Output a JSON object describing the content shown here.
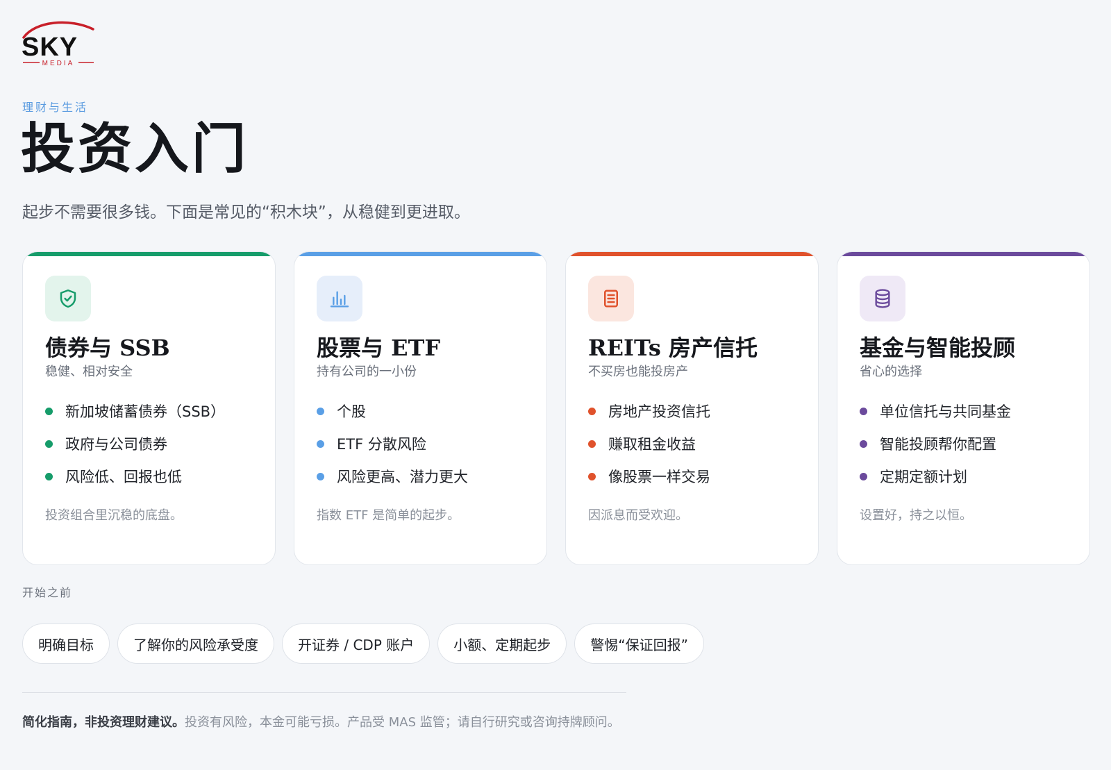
{
  "brand": {
    "logo_main": "SKY",
    "logo_sub": "MEDIA"
  },
  "header": {
    "eyebrow": "理财与生活",
    "title": "投资入门",
    "subtitle": "起步不需要很多钱。下面是常见的“积木块”，从稳健到更进取。"
  },
  "colors": {
    "green": "#169c6a",
    "blue": "#5a9fe6",
    "orange": "#e0522c",
    "purple": "#6b4a9c"
  },
  "cards": [
    {
      "icon": "shield-check-icon",
      "accent": "#169c6a",
      "icon_bg": "#e3f4ec",
      "title": "债券与 SSB",
      "subtitle": "稳健、相对安全",
      "items": [
        "新加坡储蓄债券（SSB）",
        "政府与公司债券",
        "风险低、回报也低"
      ],
      "note": "投资组合里沉稳的底盘。"
    },
    {
      "icon": "bar-chart-icon",
      "accent": "#5a9fe6",
      "icon_bg": "#e6eefa",
      "title": "股票与 ETF",
      "subtitle": "持有公司的一小份",
      "items": [
        "个股",
        "ETF 分散风险",
        "风险更高、潜力更大"
      ],
      "note": "指数 ETF 是简单的起步。"
    },
    {
      "icon": "document-icon",
      "accent": "#e0522c",
      "icon_bg": "#fbe6df",
      "title": "REITs 房产信托",
      "subtitle": "不买房也能投房产",
      "items": [
        "房地产投资信托",
        "赚取租金收益",
        "像股票一样交易"
      ],
      "note": "因派息而受欢迎。"
    },
    {
      "icon": "database-icon",
      "accent": "#6b4a9c",
      "icon_bg": "#efe9f6",
      "title": "基金与智能投顾",
      "subtitle": "省心的选择",
      "items": [
        "单位信托与共同基金",
        "智能投顾帮你配置",
        "定期定额计划"
      ],
      "note": "设置好，持之以恒。"
    }
  ],
  "before": {
    "label": "开始之前",
    "chips": [
      "明确目标",
      "了解你的风险承受度",
      "开证券 / CDP 账户",
      "小额、定期起步",
      "警惕“保证回报”"
    ]
  },
  "disclaimer": {
    "bold": "简化指南，非投资理财建议。",
    "text": "投资有风险，本金可能亏损。产品受 MAS 监管；请自行研究或咨询持牌顾问。"
  }
}
